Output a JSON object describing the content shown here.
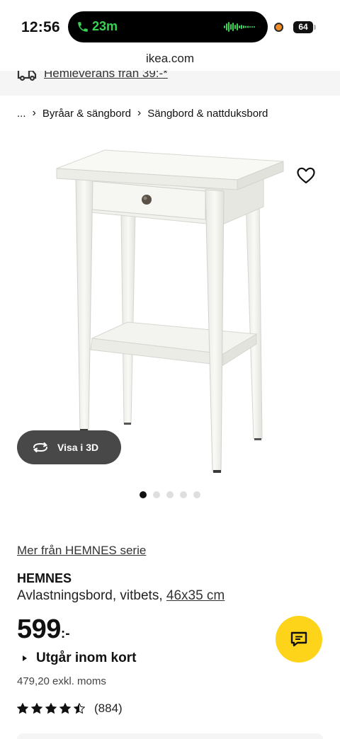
{
  "status_bar": {
    "time": "12:56",
    "call_duration": "23m",
    "battery": "64"
  },
  "browser": {
    "url": "ikea.com"
  },
  "banner": {
    "text": "Hemleverans från 39:-*"
  },
  "breadcrumb": [
    {
      "label": "..."
    },
    {
      "label": "Byråar & sängbord"
    },
    {
      "label": "Sängbord & nattduksbord"
    }
  ],
  "gallery": {
    "view_3d_label": "Visa i 3D",
    "dot_count": 5,
    "active_index": 0
  },
  "product": {
    "series_link": "Mer från HEMNES serie",
    "name": "HEMNES",
    "description": "Avlastningsbord, vitbets,",
    "size": "46x35 cm",
    "price": "599",
    "price_suffix": ":-",
    "phase_out": "Utgår inom kort",
    "price_ex_vat": "479,20 exkl. moms",
    "rating_stars": 4.5,
    "review_count": "(884)"
  },
  "colors": {
    "accent_yellow": "#fdd41a",
    "call_green": "#39d353",
    "button_gray": "#484848"
  }
}
